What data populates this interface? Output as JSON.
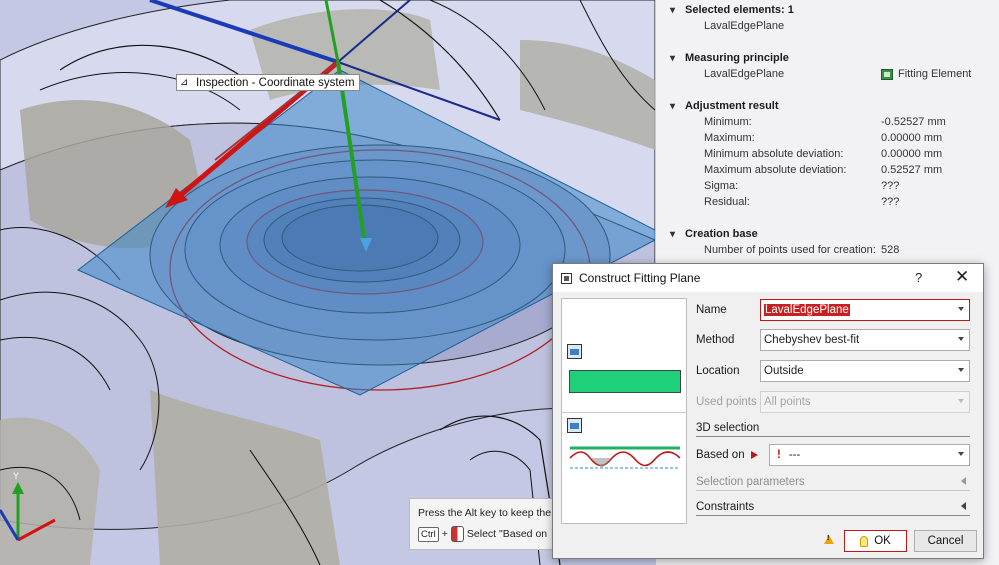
{
  "viewport": {
    "cs_label": "Inspection - Coordinate system",
    "axis_y_label": "Y",
    "hint_line1": "Press the Alt key to keep the",
    "hint_key": "Ctrl",
    "hint_plus": "+",
    "hint_line2": "Select \"Based on"
  },
  "properties": {
    "selected_elements_label": "Selected elements: 1",
    "selected_name": "LavalEdgePlane",
    "measuring_principle": {
      "header": "Measuring principle",
      "name": "LavalEdgePlane",
      "type": "Fitting Element"
    },
    "adjustment_result": {
      "header": "Adjustment result",
      "rows": [
        {
          "label": "Minimum:",
          "value": "-0.52527 mm"
        },
        {
          "label": "Maximum:",
          "value": "0.00000 mm"
        },
        {
          "label": "Minimum absolute deviation:",
          "value": "0.00000 mm"
        },
        {
          "label": "Maximum absolute deviation:",
          "value": "0.52527 mm"
        },
        {
          "label": "Sigma:",
          "value": "???"
        },
        {
          "label": "Residual:",
          "value": "???"
        }
      ]
    },
    "creation_base": {
      "header": "Creation base",
      "points_label": "Number of points used for creation:",
      "points_value": "528"
    }
  },
  "dialog": {
    "title": "Construct Fitting Plane",
    "help": "?",
    "close": "✕",
    "name_label": "Name",
    "name_value": "LavalEdgePlane",
    "method_label": "Method",
    "method_value": "Chebyshev best-fit",
    "location_label": "Location",
    "location_value": "Outside",
    "used_points_label": "Used points",
    "used_points_value": "All points",
    "selection_3d": "3D selection",
    "based_on_label": "Based on",
    "based_on_value": "---",
    "selection_params": "Selection parameters",
    "constraints": "Constraints",
    "ok_label": "OK",
    "cancel_label": "Cancel",
    "colors": {
      "accent_red": "#c01818",
      "plane_green": "#1fd07a"
    }
  }
}
